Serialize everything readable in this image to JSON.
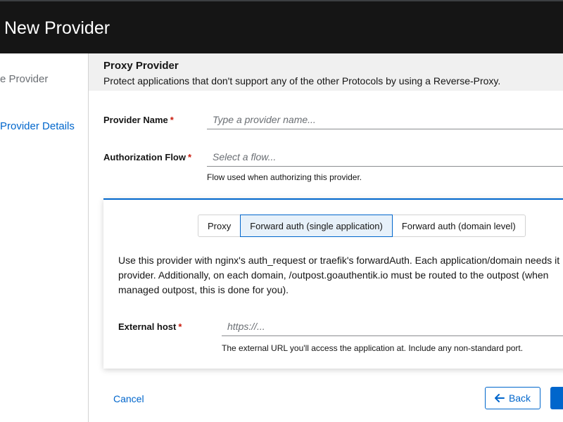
{
  "header": {
    "title": "New Provider"
  },
  "sidebar": {
    "steps": [
      {
        "label": "e Provider"
      },
      {
        "label": "Provider Details"
      }
    ]
  },
  "intro": {
    "title": "Proxy Provider",
    "description": "Protect applications that don't support any of the other Protocols by using a Reverse-Proxy."
  },
  "form": {
    "provider_name": {
      "label": "Provider Name",
      "required": "*",
      "placeholder": "Type a provider name..."
    },
    "authorization_flow": {
      "label": "Authorization Flow",
      "required": "*",
      "placeholder": "Select a flow...",
      "helper": "Flow used when authorizing this provider."
    }
  },
  "mode": {
    "options": [
      "Proxy",
      "Forward auth (single application)",
      "Forward auth (domain level)"
    ],
    "selected": "Forward auth (single application)",
    "description_lines": [
      "Use this provider with nginx's auth_request or traefik's forwardAuth. Each application/domain needs it",
      "provider. Additionally, on each domain, /outpost.goauthentik.io must be routed to the outpost (when",
      "managed outpost, this is done for you)."
    ],
    "external_host": {
      "label": "External host",
      "required": "*",
      "placeholder": "https://...",
      "helper": "The external URL you'll access the application at. Include any non-standard port."
    }
  },
  "footer": {
    "cancel_label": "Cancel",
    "back_label": "Back"
  },
  "colors": {
    "accent": "#0066cc",
    "required": "#c9190b",
    "header_bg": "#151515"
  },
  "icons": {
    "back": "arrow-left-icon"
  }
}
